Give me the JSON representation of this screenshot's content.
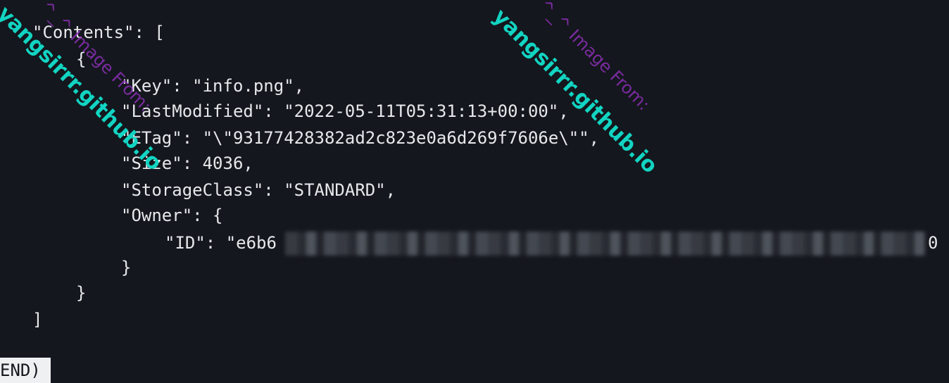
{
  "terminal": {
    "lines": [
      "\"Contents\": [",
      "{",
      "\"Key\": \"info.png\",",
      "\"LastModified\": \"2022-05-11T05:31:13+00:00\",",
      "\"ETag\": \"\\\"93177428382ad2c823e0a6d269f7606e\\\"\",",
      "\"Size\": 4036,",
      "\"StorageClass\": \"STANDARD\",",
      "\"Owner\": {",
      "\"ID\": \"e6b6",
      "}",
      "}",
      "]"
    ],
    "id_tail": "0",
    "prompt": "END)"
  },
  "watermarks": {
    "site": "yangsirrr.github.io",
    "from": "^_^ Image From:"
  },
  "colors": {
    "background": "#14171d",
    "text": "#e6e8eb",
    "watermark_site": "#12d4c2",
    "watermark_from": "#8b2fb6"
  }
}
